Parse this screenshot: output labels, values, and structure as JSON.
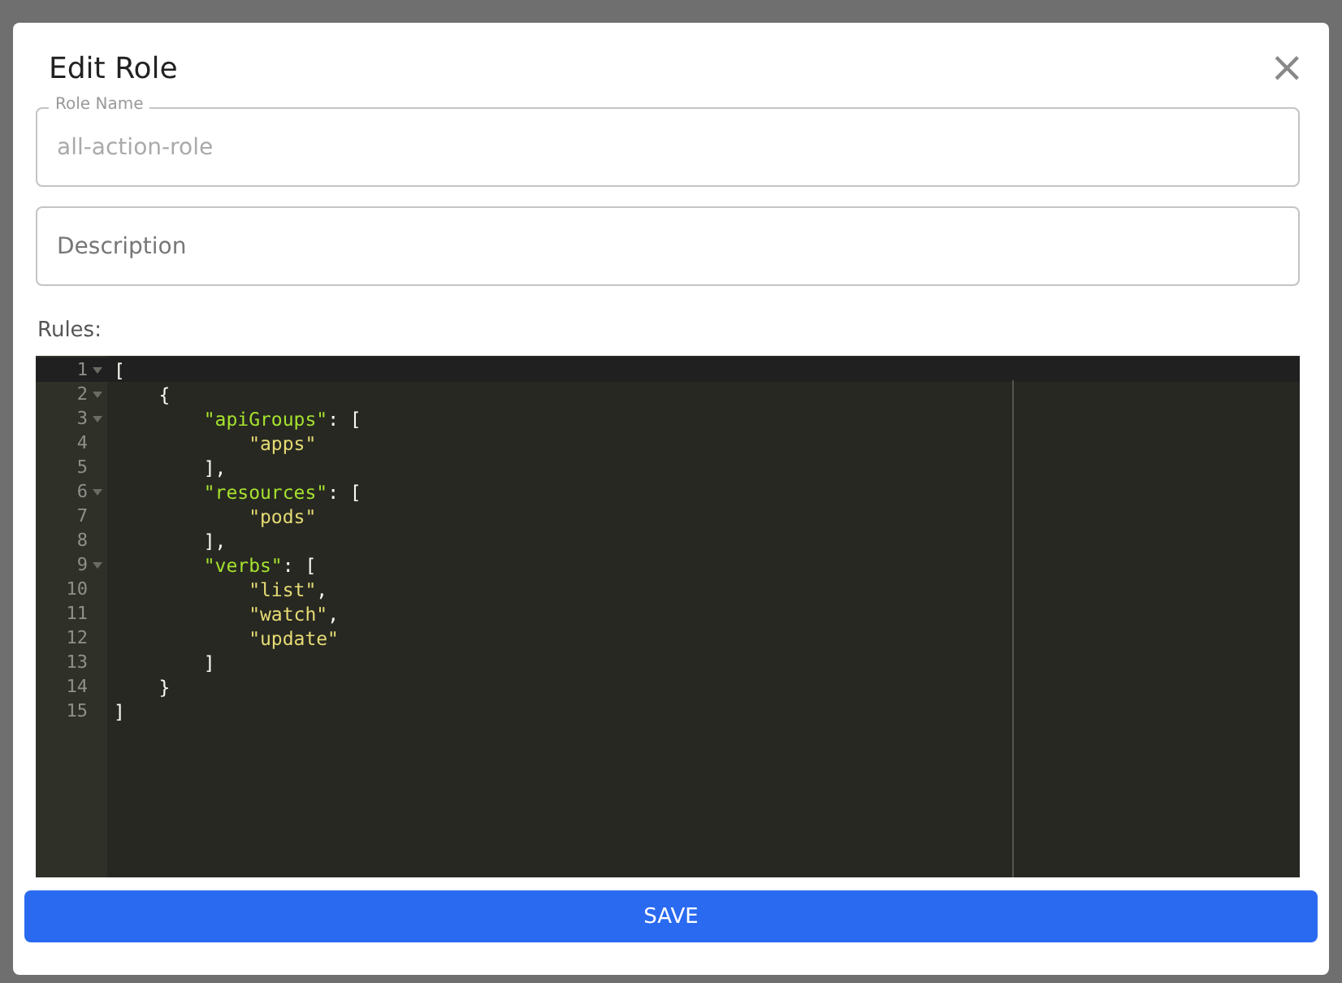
{
  "dialog": {
    "title": "Edit Role",
    "close_symbol": "×"
  },
  "fields": [
    {
      "label": "Role Name",
      "value": "all-action-role",
      "disabled": true
    },
    {
      "placeholder": "Description"
    }
  ],
  "rules_label": "Rules:",
  "editor": {
    "lines": [
      {
        "number": "1",
        "fold": true,
        "active": true,
        "tokens": [
          {
            "kind": "punct",
            "text": "["
          }
        ]
      },
      {
        "number": "2",
        "fold": true,
        "active": false,
        "tokens": [
          {
            "kind": "punct",
            "text": "    {"
          }
        ]
      },
      {
        "number": "3",
        "fold": true,
        "active": false,
        "tokens": [
          {
            "kind": "key",
            "text": "        \"apiGroups\""
          },
          {
            "kind": "punct",
            "text": ": ["
          }
        ]
      },
      {
        "number": "4",
        "fold": false,
        "active": false,
        "tokens": [
          {
            "kind": "string",
            "text": "            \"apps\""
          }
        ]
      },
      {
        "number": "5",
        "fold": false,
        "active": false,
        "tokens": [
          {
            "kind": "punct",
            "text": "        ],"
          }
        ]
      },
      {
        "number": "6",
        "fold": true,
        "active": false,
        "tokens": [
          {
            "kind": "key",
            "text": "        \"resources\""
          },
          {
            "kind": "punct",
            "text": ": ["
          }
        ]
      },
      {
        "number": "7",
        "fold": false,
        "active": false,
        "tokens": [
          {
            "kind": "string",
            "text": "            \"pods\""
          }
        ]
      },
      {
        "number": "8",
        "fold": false,
        "active": false,
        "tokens": [
          {
            "kind": "punct",
            "text": "        ],"
          }
        ]
      },
      {
        "number": "9",
        "fold": true,
        "active": false,
        "tokens": [
          {
            "kind": "key",
            "text": "        \"verbs\""
          },
          {
            "kind": "punct",
            "text": ": ["
          }
        ]
      },
      {
        "number": "10",
        "fold": false,
        "active": false,
        "tokens": [
          {
            "kind": "string",
            "text": "            \"list\""
          },
          {
            "kind": "punct",
            "text": ","
          }
        ]
      },
      {
        "number": "11",
        "fold": false,
        "active": false,
        "tokens": [
          {
            "kind": "string",
            "text": "            \"watch\""
          },
          {
            "kind": "punct",
            "text": ","
          }
        ]
      },
      {
        "number": "12",
        "fold": false,
        "active": false,
        "tokens": [
          {
            "kind": "string",
            "text": "            \"update\""
          }
        ]
      },
      {
        "number": "13",
        "fold": false,
        "active": false,
        "tokens": [
          {
            "kind": "punct",
            "text": "        ]"
          }
        ]
      },
      {
        "number": "14",
        "fold": false,
        "active": false,
        "tokens": [
          {
            "kind": "punct",
            "text": "    }"
          }
        ]
      },
      {
        "number": "15",
        "fold": false,
        "active": false,
        "tokens": [
          {
            "kind": "punct",
            "text": "]"
          }
        ]
      }
    ]
  },
  "save_button": "SAVE"
}
